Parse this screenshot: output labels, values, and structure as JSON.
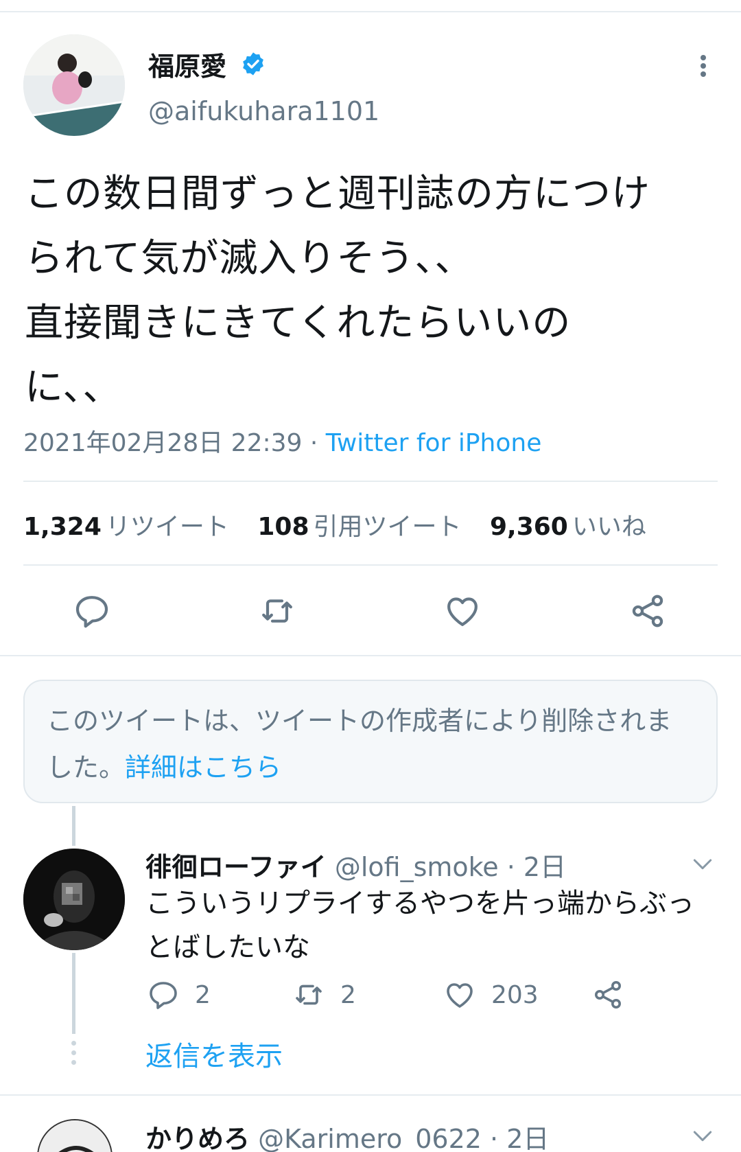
{
  "tweet": {
    "author_name": "福原愛",
    "handle": "@aifukuhara1101",
    "text": "この数日間ずっと週刊誌の方につけ\nられて気が滅入りそう、、\n直接聞きにきてくれたらいいの\nに、、",
    "timestamp": "2021年02月28日 22:39",
    "separator": " · ",
    "source": "Twitter for iPhone",
    "stats": {
      "retweets_count": "1,324",
      "retweets_label": "リツイート",
      "quotes_count": "108",
      "quotes_label": "引用ツイート",
      "likes_count": "9,360",
      "likes_label": "いいね"
    },
    "actions": [
      "reply-icon",
      "retweet-icon",
      "like-icon",
      "share-icon"
    ]
  },
  "deleted_notice": {
    "text": "このツイートは、ツイートの作成者により削除されました。",
    "link": "詳細はこちら"
  },
  "reply": {
    "name": "徘徊ローファイ",
    "handle": "@lofi_smoke",
    "time": " · 2日",
    "text": "こういうリプライするやつを片っ端からぶっ\nとばしたいな",
    "reply_count": "2",
    "retweet_count": "2",
    "like_count": "203",
    "show_replies": "返信を表示"
  },
  "next_reply": {
    "name": "かりめろ",
    "handle": "@Karimero_0622",
    "time": " · 2日"
  },
  "colors": {
    "accent": "#1da1f2",
    "secondary_text": "#657786",
    "divider": "#e6ecf0"
  }
}
